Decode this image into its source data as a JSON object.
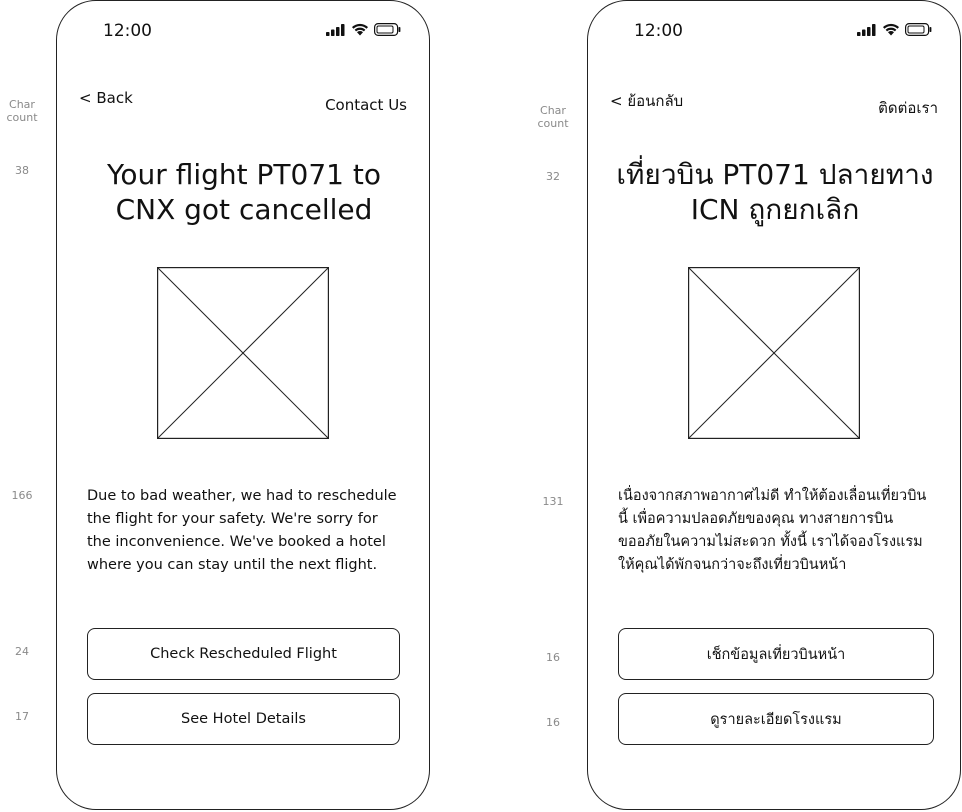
{
  "char_count_header": "Char count",
  "english": {
    "status_time": "12:00",
    "back_label": "< Back",
    "contact_label": "Contact Us",
    "title": "Your flight PT071 to CNX got cancelled",
    "title_count": "38",
    "body": "Due to bad weather, we had to reschedule the flight for your safety. We're sorry for the inconvenience. We've booked a hotel where you can stay until the next flight.",
    "body_count": "166",
    "primary_button": "Check Rescheduled Flight",
    "primary_count": "24",
    "secondary_button": "See Hotel Details",
    "secondary_count": "17"
  },
  "thai": {
    "status_time": "12:00",
    "back_label": "< ย้อนกลับ",
    "contact_label": "ติดต่อเรา",
    "title": "เที่ยวบิน PT071 ปลายทาง ICN ถูกยกเลิก",
    "title_count": "32",
    "body": "เนื่องจากสภาพอากาศไม่ดี ทำให้ต้องเลื่อนเที่ยวบินนี้ เพื่อความปลอดภัยของคุณ ทางสายการบินขออภัยในความไม่สะดวก ทั้งนี้ เราได้จองโรงแรมให้คุณได้พักจนกว่าจะถึงเที่ยวบินหน้า",
    "body_count": "131",
    "primary_button": "เช็กข้อมูลเที่ยวบินหน้า",
    "primary_count": "16",
    "secondary_button": "ดูรายละเอียดโรงแรม",
    "secondary_count": "16"
  },
  "icons": [
    "signal-icon",
    "wifi-icon",
    "battery-icon",
    "image-placeholder-icon"
  ]
}
